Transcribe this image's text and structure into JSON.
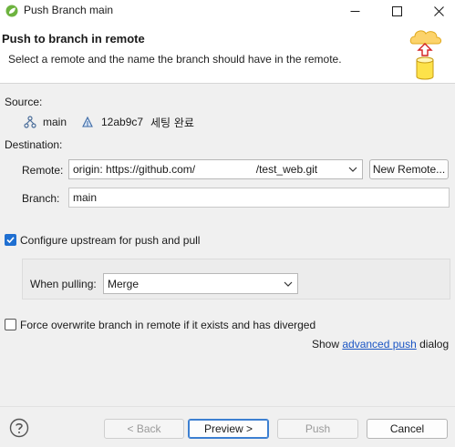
{
  "window": {
    "title": "Push Branch main",
    "app_icon": "spring-leaf-icon",
    "controls": [
      "minimize-icon",
      "maximize-icon",
      "close-icon"
    ]
  },
  "header": {
    "title": "Push to branch in remote",
    "description": "Select a remote and the name the branch should have in the remote.",
    "icon": "cloud-upload-repository-icon"
  },
  "source": {
    "label": "Source:",
    "branch_icon": "branch-icon",
    "branch": "main",
    "commit_icon": "commit-icon",
    "commit_id": "12ab9c7",
    "commit_message": "세팅 완료"
  },
  "destination": {
    "label": "Destination:",
    "remote_label": "Remote:",
    "remote_value": "origin: https://github.com/                    /test_web.git",
    "new_remote_button": "New Remote...",
    "branch_label": "Branch:",
    "branch_value": "main"
  },
  "upstream": {
    "checked": true,
    "label": "Configure upstream for push and pull",
    "when_pulling_label": "When pulling:",
    "when_pulling_value": "Merge"
  },
  "force": {
    "checked": false,
    "label": "Force overwrite branch in remote if it exists and has diverged"
  },
  "advanced": {
    "prefix": "Show ",
    "link": "advanced push",
    "suffix": " dialog"
  },
  "footer": {
    "help_icon": "help-icon",
    "back": "< Back",
    "preview": "Preview >",
    "push": "Push",
    "cancel": "Cancel"
  },
  "colors": {
    "accent": "#1f6fd1",
    "link": "#1a55c4"
  }
}
